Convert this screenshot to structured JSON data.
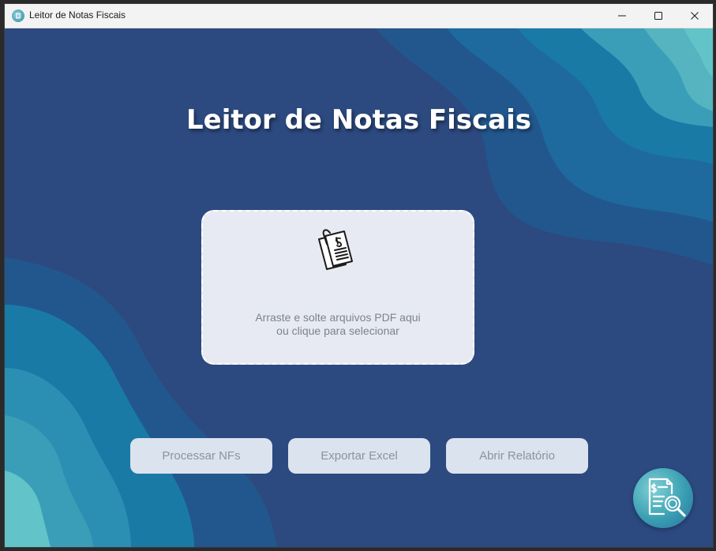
{
  "window": {
    "title": "Leitor de Notas Fiscais",
    "controls": {
      "minimize": "minimize",
      "maximize": "maximize",
      "close": "close"
    }
  },
  "main": {
    "heading": "Leitor de Notas Fiscais"
  },
  "dropzone": {
    "line1": "Arraste e solte arquivos PDF aqui",
    "line2": "ou clique para selecionar",
    "icon": "invoice-documents-icon"
  },
  "actions": {
    "process_label": "Processar NFs",
    "export_label": "Exportar Excel",
    "report_label": "Abrir Relatório"
  },
  "fab": {
    "icon": "report-search-icon"
  },
  "colors": {
    "background": "#2c4a80",
    "wave_dark": "#22578e",
    "wave_mid": "#1a7aa6",
    "wave_light": "#3b9eb8",
    "wave_lightest": "#62c3c8",
    "dropzone_bg": "#e7eaf3",
    "button_bg": "#dbe3ee",
    "button_text": "#8c939c"
  }
}
